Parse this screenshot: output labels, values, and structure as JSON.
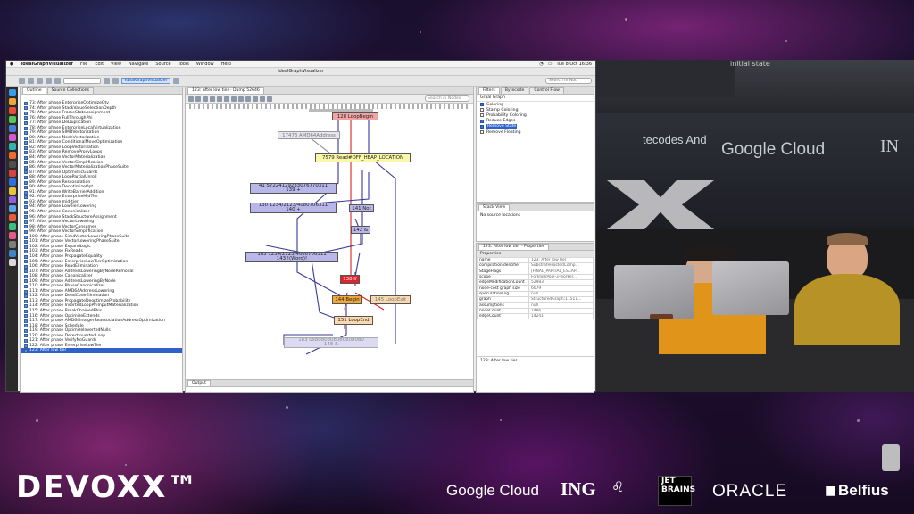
{
  "menubar": {
    "app": "IdealGraphVisualizer",
    "items": [
      "File",
      "Edit",
      "View",
      "Navigate",
      "Source",
      "Tools",
      "Window",
      "Help"
    ],
    "clock": "Tue 8 Oct 16:36"
  },
  "window_title": "IdealGraphVisualizer",
  "toolbar": {
    "active_button": "IdealGraphVisualizer",
    "search_placeholder": "Search in Nod"
  },
  "outline": {
    "tabs": [
      "Outline",
      "Source Collections"
    ],
    "items": [
      "73: After phase EnterpriseOptimizeOtv",
      "74: After phase StackValueSelectionDepth",
      "75: After phase FrameStateAssignment",
      "76: After phase FullThroughPhi",
      "77: After phase DeDuplication",
      "78: After phase EnterpriseLocalVirtualization",
      "79: After phase SIMDVectorization",
      "80: After phase NodeVectorization",
      "81: After phase ConditionalMoveOptimization",
      "82: After phase LoopVectorization",
      "83: After phase RemoveProxyLoops",
      "84: After phase VectorMaterialization",
      "85: After phase VectorSimplification",
      "86: After phase VectorMaterializationPhaseSuite",
      "87: After phase OptimisticGuards",
      "88: After phase LoopPartialUnroll",
      "89: After phase Rescosolation",
      "90: After phase DeoptimizeOpt",
      "91: After phase WriteBarrierAddition",
      "92: After phase EnterpriseMidTier",
      "93: After phase mid-tier",
      "94: After phase LowTierLowering",
      "95: After phase Canonicalizer",
      "96: After phase StackStructureAssignment",
      "97: After phase VectorLowering",
      "98: After phase VectorConsumer",
      "99: After phase VectorSimplification",
      "100: After phase SimdVectorLoweringPhaseSuite",
      "101: After phase VectorLoweringPhaseSuite",
      "102: After phase ExpandLogic",
      "103: After phase FixReads",
      "104: After phase PropagateEquality",
      "105: After phase EnterpriseLowTierOptimization",
      "106: After phase ReadElimination",
      "107: After phase AddressLoweringByNodeRemoval",
      "108: After phase Canonicalizer",
      "109: After phase AddressLoweringByNode",
      "110: After phase PhaseCanonicalizer",
      "111: After phase AMD64AddressLowering",
      "112: After phase DeadCodeElimination",
      "113: After phase PropagateDeoptimizeProbability",
      "114: After phase InsertedLoopPhiInputMaterialization",
      "115: After phase BreakChainedPhis",
      "116: After phase OptimizeExtends",
      "117: After phase AMD64IntegerReassociationAddressOptimization",
      "118: After phase Schedule",
      "119: After phase OptimizeInvertedNulls",
      "120: After phase DetectInvertedLoop",
      "121: After phase VerifyNoGuards",
      "122: After phase EnterpriseLowTier",
      "123: After low tier"
    ]
  },
  "graph_tab": "123: After low tier - Dump 52646",
  "graph_search_placeholder": "Search in Nodes",
  "output_tab": "Output",
  "graph_nodes": {
    "loop_begin": "128 LoopBegin",
    "amd64_address": "17473 AMD64Address",
    "read": "7579 Read#OFF_HEAP_LOCATION",
    "v139_label": "41 57224129233076770311",
    "v139": "139 +",
    "v140_label": "130 1234/2123/4080706311",
    "v140": "140 +",
    "not141": "141 Not",
    "and142": "142 &",
    "v143_label": "185 1234/2123/4080706311",
    "v143": "143 !(Word)!",
    "if138": "138 If",
    "begin144": "144 Begin",
    "loopexit145": "145 LoopExit",
    "loopend151": "151 LoopEnd",
    "v148_label": "183 0x8080808080808080",
    "v148": "148 &"
  },
  "filters": {
    "tabs": [
      "Filters",
      "Bytecode",
      "Control Flow"
    ],
    "header": "Graal Graph",
    "items": [
      {
        "label": "Coloring",
        "checked": true
      },
      {
        "label": "Stamp Coloring",
        "checked": false
      },
      {
        "label": "Probability Coloring",
        "checked": false
      },
      {
        "label": "Reduce Edges",
        "checked": true
      },
      {
        "label": "Remove State",
        "checked": true,
        "selected": true
      },
      {
        "label": "Remove Floating",
        "checked": false
      }
    ]
  },
  "stack_view": {
    "tab": "Stack View",
    "text": "No source locations"
  },
  "properties": {
    "tab": "123: After low tier - Properties",
    "header": "Properties",
    "rows": [
      {
        "k": "name",
        "v": "123: After low tier"
      },
      {
        "k": "compilationIdentifier",
        "v": "SubstrateHostedComp..."
      },
      {
        "k": "StageFlags",
        "v": "[FINAL_PARTIAL_ESCAP..."
      },
      {
        "k": "scope",
        "v": "ForkJoinPool-3-worker..."
      },
      {
        "k": "edgeModificationCount",
        "v": "52983"
      },
      {
        "k": "node-cost graph size",
        "v": "6079"
      },
      {
        "k": "speculationLog",
        "v": "null"
      },
      {
        "k": "graph",
        "v": "StructuredGraph:11511..."
      },
      {
        "k": "assumptions",
        "v": "null"
      },
      {
        "k": "nodeCount",
        "v": "7486"
      },
      {
        "k": "edgeCount",
        "v": "14241"
      }
    ],
    "footer": "123: After low tier"
  },
  "video": {
    "screen_text_1": "initial state",
    "screen_text_2": "tecodes And",
    "sponsor_google": "Google Cloud",
    "sponsor_ing": "IN"
  },
  "brand": {
    "devoxx": "DEVOXX™",
    "google": "Google Cloud",
    "ing": "ING",
    "jet": "JET",
    "brains": "BRAINS",
    "oracle": "ORACLE",
    "belfius": "Belfius"
  }
}
